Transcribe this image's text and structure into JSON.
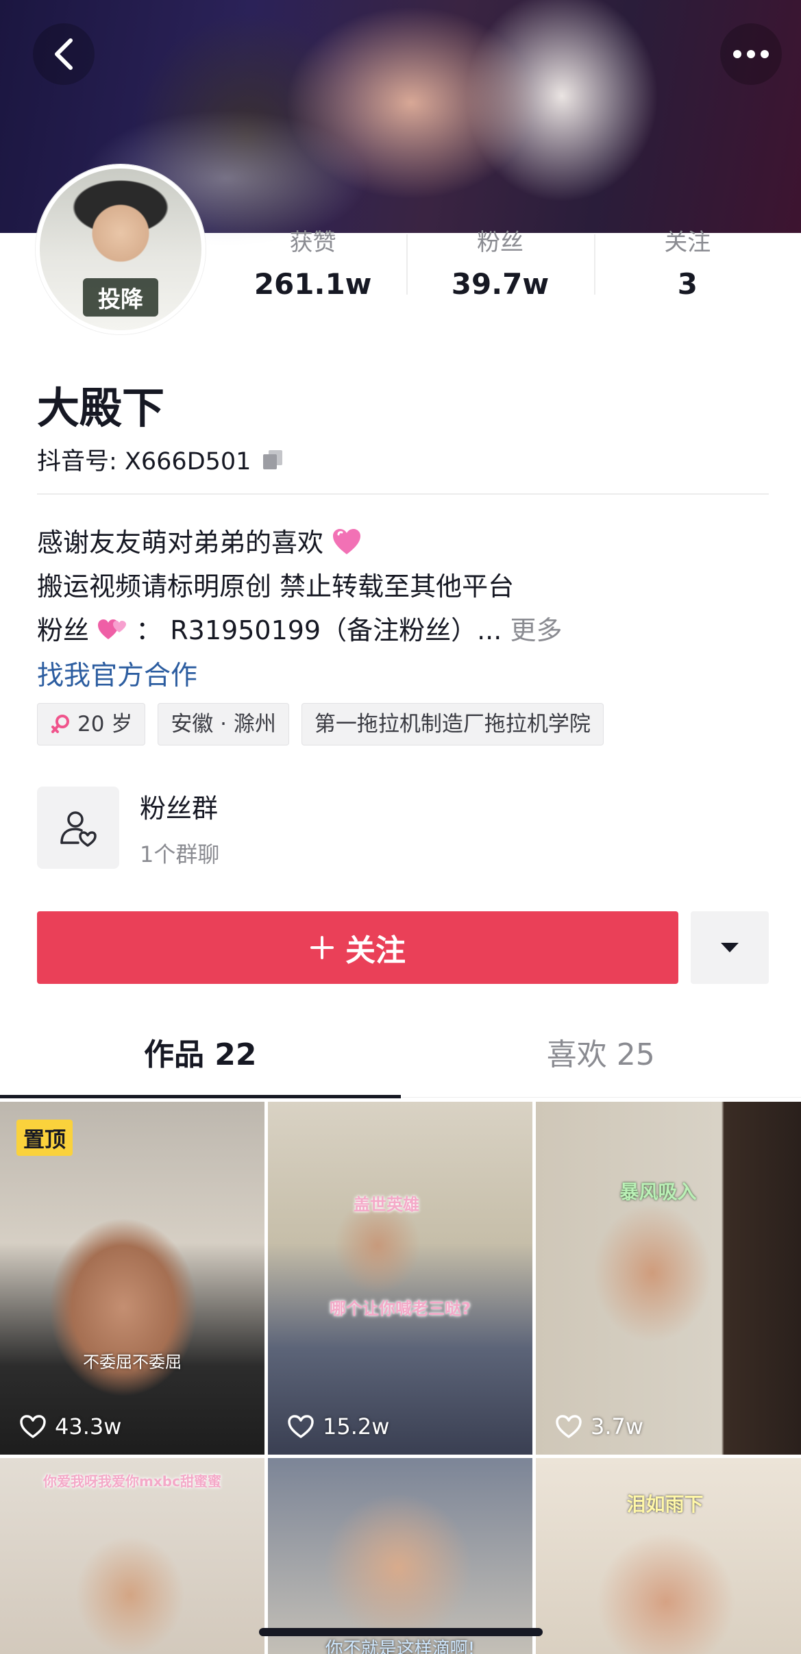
{
  "header": {
    "back_icon": "chevron-left-icon",
    "more_icon": "ellipsis-icon"
  },
  "profile": {
    "avatar_badge": "投降",
    "name": "大殿下",
    "uid_label": "抖音号: X666D501",
    "stats": [
      {
        "label": "获赞",
        "value": "261.1w"
      },
      {
        "label": "粉丝",
        "value": "39.7w"
      },
      {
        "label": "关注",
        "value": "3"
      }
    ],
    "bio": {
      "line1": "感谢友友萌对弟弟的喜欢",
      "line2": "搬运视频请标明原创 禁止转载至其他平台",
      "line3_prefix": "粉丝",
      "line3_text": "： R31950199（备注粉丝）...",
      "more": "更多"
    },
    "official_link": "找我官方合作",
    "tags": [
      {
        "icon": "female-icon",
        "label": "20 岁"
      },
      {
        "label": "安徽 · 滁州"
      },
      {
        "label": "第一拖拉机制造厂拖拉机学院"
      }
    ]
  },
  "fan_group": {
    "title": "粉丝群",
    "subtitle": "1个群聊"
  },
  "actions": {
    "follow_label": "关注",
    "follow_color": "#ea4058"
  },
  "tabs": [
    {
      "label": "作品 22",
      "active": true
    },
    {
      "label": "喜欢 25",
      "active": false
    }
  ],
  "videos": [
    {
      "pinned_label": "置顶",
      "caption": "不委屈不委屈",
      "likes": "43.3w"
    },
    {
      "caption_top": "盖世英雄",
      "caption": "哪个让你喊老三哒?",
      "likes": "15.2w"
    },
    {
      "caption_top": "暴风吸入",
      "likes": "3.7w"
    },
    {
      "caption_top": "你爱我呀我爱你mxbc甜蜜蜜"
    },
    {
      "caption_bottom": "你不就是这样滴啊!"
    },
    {
      "caption_top": "泪如雨下"
    }
  ]
}
